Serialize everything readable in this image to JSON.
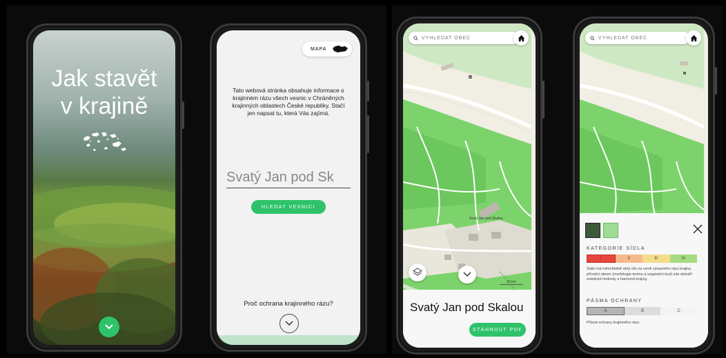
{
  "screen1": {
    "title_line1": "Jak stavět",
    "title_line2": "v krajině"
  },
  "screen2": {
    "map_button_label": "MAPA",
    "intro_text": "Tato webová stránka obsahuje informace o krajinném rázu všech vesnic v Chráněných krajinných oblastech České republiky. Stačí jen napsat tu, která Vás zajímá.",
    "search_value": "Svatý Jan pod Sk",
    "search_button_label": "HLEDAT VESNICI",
    "why_text": "Proč ochrana krajinného rázu?"
  },
  "screen3": {
    "search_placeholder": "VYHLEDAT OBEC",
    "map_label_village": "Svatý Jan pod Skalou",
    "scale_label": "20 km",
    "place_title": "Svatý Jan pod Skalou",
    "download_label": "STÁHNOUT PDF"
  },
  "screen4": {
    "search_placeholder": "VYHLEDAT OBEC",
    "category_heading": "KATEGORIE SÍDLA",
    "categories": [
      "I",
      "II",
      "III",
      "IV"
    ],
    "category_colors": [
      "#e8453c",
      "#f6b98a",
      "#f4dd8a",
      "#a6dc7f"
    ],
    "category_desc": "Sídlo má mimořádně silný vliv na vznik výrazného rázu krajiny, přírodní rámec (morfologie terénu a vegetační kryt) zde dotváří estetické hodnoty a harmonii krajiny.",
    "zone_heading": "PÁSMA OCHRANY",
    "zones": [
      "A",
      "B",
      "C"
    ],
    "zone_note": "Přísné ochrany krajinného rázu"
  },
  "colors": {
    "accent_green": "#2ec36a",
    "map_green": "#7cd36b"
  }
}
